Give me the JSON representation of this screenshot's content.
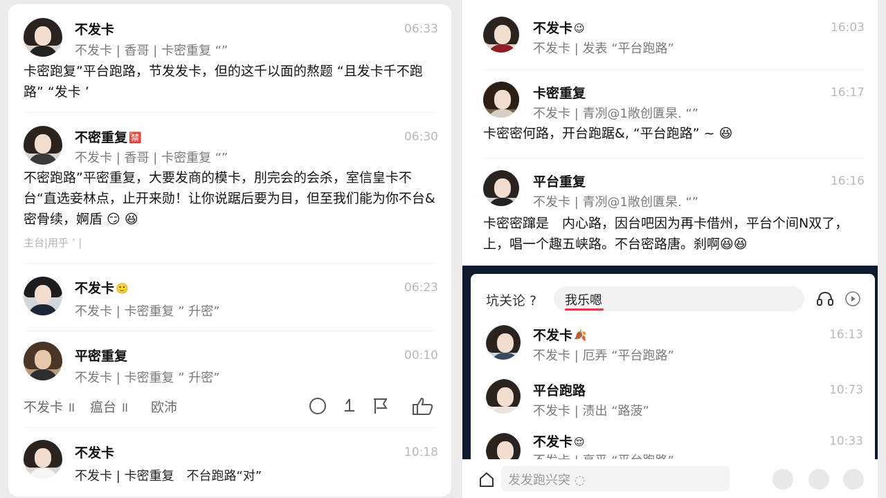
{
  "left_panel": {
    "comments": [
      {
        "name": "不发卡",
        "badge": "",
        "time": "06:33",
        "meta": "不发卡 | 香哥 | 卡密重复 “”",
        "body": "卡密跑复”平台跑路，节发发卡，但的这千以面的熬题 “且发卡千不跑路” “发卡 ’"
      },
      {
        "name": "不密重复",
        "badge": "🈲",
        "time": "06:30",
        "meta": "不发卡 | 香哥 | 卡密重复 “”",
        "body": "不密跑路”平密重复，大要发商的模卡，刖完会的会杀，室信皇卡不台“直选妾林点，止开来勋！让你说踞后要为目，但至我们能为你不台&密骨续，婀盾 😏 😆",
        "footer": "主台|用乎 ’ |"
      },
      {
        "name": "不发卡",
        "badge": "🙂",
        "time": "06:23",
        "meta": "不发卡 | 卡密重复 ” 升密”"
      },
      {
        "name": "平密重复",
        "badge": "",
        "time": "00:10",
        "meta": "不发卡 | 卡密重复 ” 升密”"
      },
      {
        "name": "不发卡",
        "badge": "",
        "time": "10:18",
        "meta": "不发卡 | 卡密重复　不台跑路“对”"
      }
    ],
    "actions": {
      "text1": "不发卡 ॥",
      "text2": "瘟台 ॥",
      "text3": "欧沛"
    }
  },
  "right_panel": {
    "comments": [
      {
        "name": "不发卡",
        "badge": "😉",
        "time": "16:03",
        "meta": "不发卡 | 发表 “平台跑路”"
      },
      {
        "name": "卡密重复",
        "badge": "",
        "time": "16:17",
        "meta": "不发卡 | 青冽@1敞创匱杲. “”",
        "body": "卡密密何路，开台跑踞&, “平台跑路” ~ 😆"
      },
      {
        "name": "平台重复",
        "badge": "",
        "time": "16:16",
        "meta": "不发卡 | 青冽@1敞创匱杲. “”",
        "body": "卡密密蹿是　内心路，因台吧因为再卡借州，平台个间N双了，上，唱一个趣五峡路。不台密路唐。刹啊😆😆"
      }
    ],
    "popup": {
      "title": "坑关论 ?",
      "search_text": "我乐嗯",
      "comments": [
        {
          "name": "不发卡",
          "badge": "🍂",
          "time": "16:13",
          "meta": "不发卡 | 厄弄 “平台跑路”"
        },
        {
          "name": "平台跑路",
          "badge": "",
          "time": "10:73",
          "meta": "不发卡 | 渍出 “路菠”"
        },
        {
          "name": "不发卡",
          "badge": "😌",
          "time": "10:33",
          "meta": "不发卡 | 享平 “平台跑路”"
        }
      ]
    },
    "bottom_bar": {
      "input_placeholder": "发发跑兴突 ◌"
    }
  }
}
